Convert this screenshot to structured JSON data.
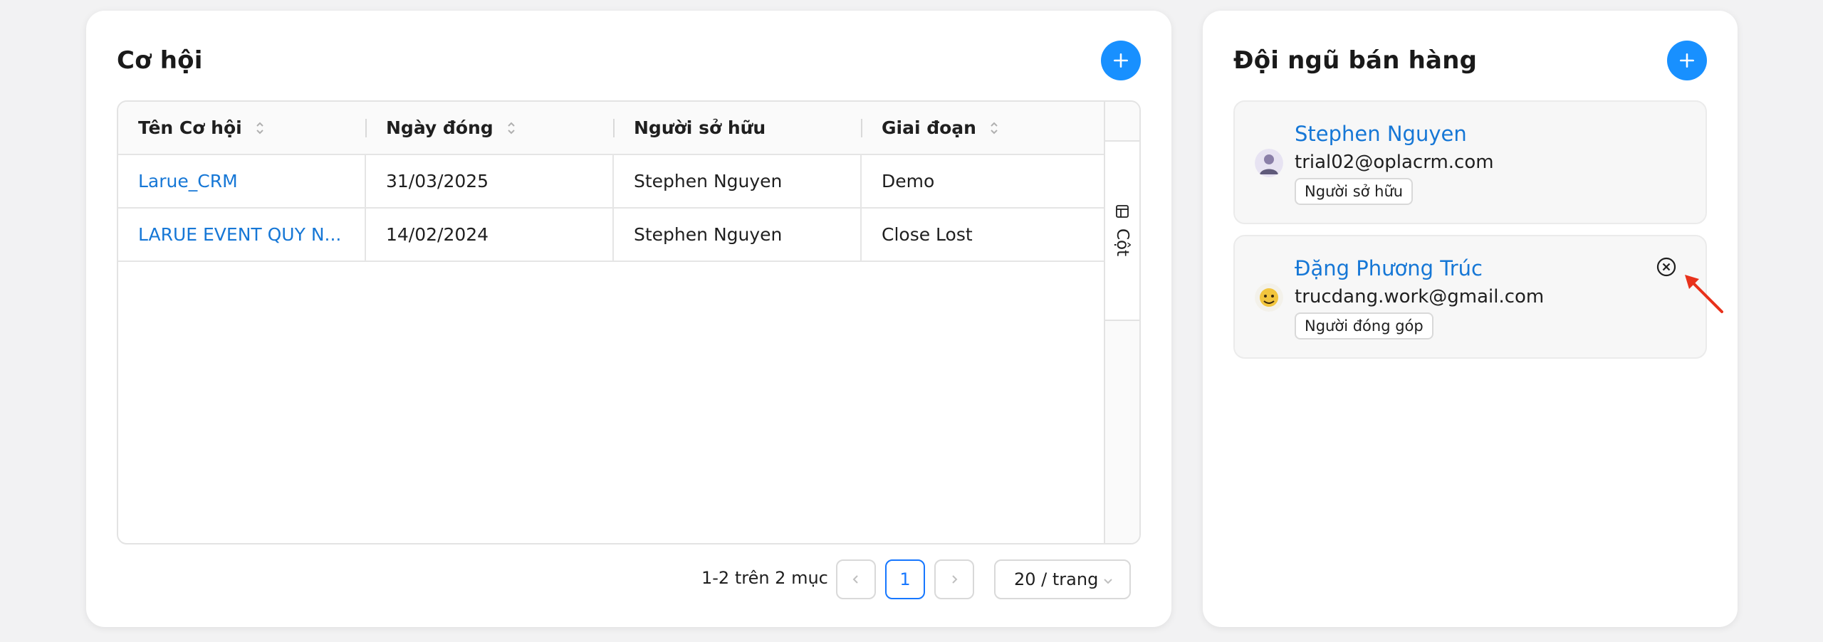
{
  "opportunities": {
    "title": "Cơ hội",
    "add_icon": "plus-icon",
    "columns": [
      "Tên Cơ hội",
      "Ngày đóng",
      "Người sở hữu",
      "Giai đoạn"
    ],
    "rows": [
      {
        "name": "Larue_CRM",
        "close_date": "31/03/2025",
        "owner": "Stephen Nguyen",
        "stage": "Demo"
      },
      {
        "name": "LARUE EVENT QUY N...",
        "close_date": "14/02/2024",
        "owner": "Stephen Nguyen",
        "stage": "Close Lost"
      }
    ],
    "column_toggle_label": "Cột",
    "pagination": {
      "info": "1-2 trên 2 mục",
      "current_page": "1",
      "page_size": "20 / trang"
    }
  },
  "team": {
    "title": "Đội ngũ bán hàng",
    "add_icon": "plus-icon",
    "members": [
      {
        "name": "Stephen Nguyen",
        "email": "trial02@oplacrm.com",
        "role": "Người sở hữu"
      },
      {
        "name": "Đặng Phương Trúc",
        "email": "trucdang.work@gmail.com",
        "role": "Người đóng góp"
      }
    ]
  },
  "colors": {
    "accent": "#1890ff",
    "link": "#1677d6",
    "annotation_arrow": "#e8321c"
  }
}
